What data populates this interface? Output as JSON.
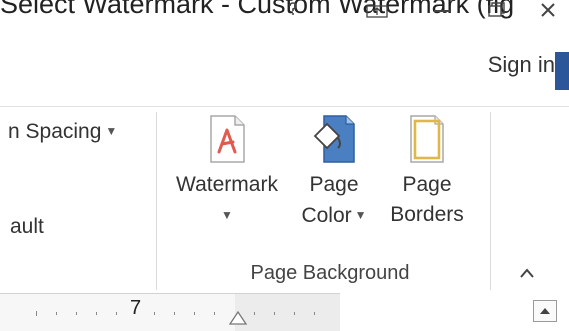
{
  "caption": "Select Watermark - Custom Watermark (fig",
  "window_controls": [
    "help-icon",
    "ribbon-display-icon",
    "minimize-icon",
    "restore-icon",
    "close-icon"
  ],
  "account": {
    "sign_in": "Sign in"
  },
  "paragraph_group": {
    "spacing_label": "n Spacing",
    "default_label": "ault"
  },
  "page_background_group": {
    "label": "Page Background",
    "tools": [
      {
        "label_line1": "Watermark",
        "label_line2": "",
        "icon": "watermark-icon",
        "dropdown": true
      },
      {
        "label_line1": "Page",
        "label_line2": "Color",
        "icon": "page-color-icon",
        "dropdown": true
      },
      {
        "label_line1": "Page",
        "label_line2": "Borders",
        "icon": "page-borders-icon",
        "dropdown": false
      }
    ]
  },
  "ruler": {
    "number": "7"
  },
  "colors": {
    "accent": "#2b579a",
    "watermark": "#e05a4e",
    "page_color": "#4a7fc1",
    "border": "#e0b84a"
  }
}
